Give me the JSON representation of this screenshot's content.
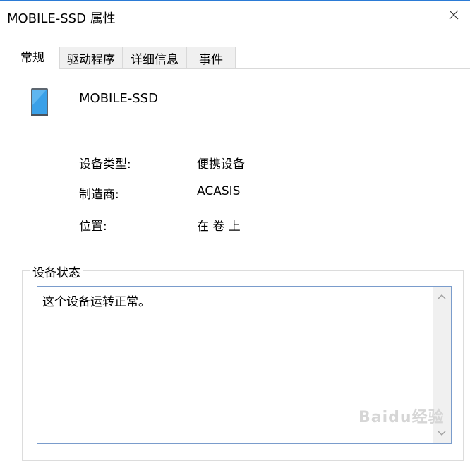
{
  "window": {
    "title": "MOBILE-SSD 属性"
  },
  "tabs": [
    {
      "label": "常规"
    },
    {
      "label": "驱动程序"
    },
    {
      "label": "详细信息"
    },
    {
      "label": "事件"
    }
  ],
  "device": {
    "name": "MOBILE-SSD",
    "icon": "portable-device-icon"
  },
  "properties": {
    "type_label": "设备类型:",
    "type_value": "便携设备",
    "manufacturer_label": "制造商:",
    "manufacturer_value": "ACASIS",
    "location_label": "位置:",
    "location_value": "在 卷 上"
  },
  "status_group": {
    "legend": "设备状态",
    "text": "这个设备运转正常。"
  },
  "watermark": {
    "text": "Baidu经验"
  },
  "colors": {
    "title_accent": "#2b7bd6",
    "status_border": "#7a9ccc",
    "device_screen": "#3aa0e8"
  }
}
